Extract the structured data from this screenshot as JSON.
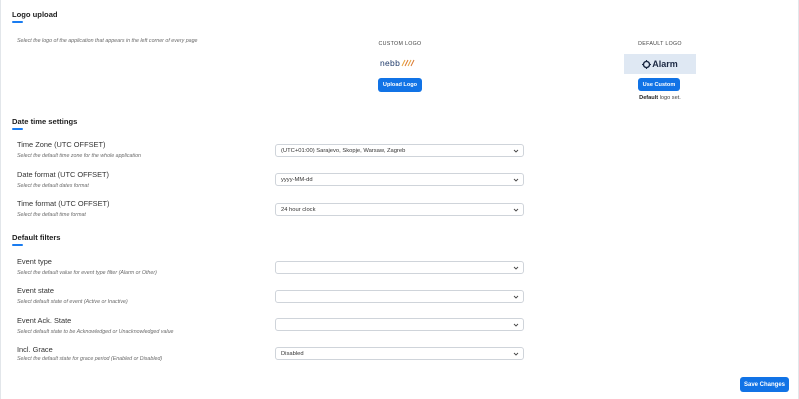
{
  "logo_upload": {
    "title": "Logo upload",
    "hint": "Select the logo of the application that appears in the left corner of every page",
    "custom_label": "CUSTOM LOGO",
    "custom_logo_text": "nebb",
    "upload_button": "Upload Logo",
    "default_label": "DEFAULT LOGO",
    "default_logo_text": "Alarm",
    "use_custom_button": "Use Custom",
    "default_note_bold": "Default",
    "default_note_rest": " logo set."
  },
  "date_time": {
    "title": "Date time settings",
    "fields": [
      {
        "label": "Time Zone (UTC OFFSET)",
        "hint": "Select the default time zone for the whole application",
        "value": "(UTC+01:00) Sarajevo, Skopje, Warsaw, Zagreb"
      },
      {
        "label": "Date format (UTC OFFSET)",
        "hint": "Select the default dates format",
        "value": "yyyy-MM-dd"
      },
      {
        "label": "Time format (UTC OFFSET)",
        "hint": "Select the default time format",
        "value": "24 hour clock"
      }
    ]
  },
  "default_filters": {
    "title": "Default filters",
    "fields": [
      {
        "label": "Event type",
        "hint": "Select the default value for event type filter (Alarm or Other)",
        "value": ""
      },
      {
        "label": "Event state",
        "hint": "Select default state of event (Active or Inactive)",
        "value": ""
      },
      {
        "label": "Event Ack. State",
        "hint": "Select default state to be Acknowledged or Unacknowledged value",
        "value": ""
      },
      {
        "label": "Incl. Grace",
        "hint": "Select the default state for grace period (Enabled or Disabled)",
        "value": "Disabled"
      }
    ]
  },
  "save_button": "Save Changes",
  "colors": {
    "accent": "#1173e6",
    "underline": "#1a7cf0",
    "default_logo_bg": "#dfe8f3"
  }
}
